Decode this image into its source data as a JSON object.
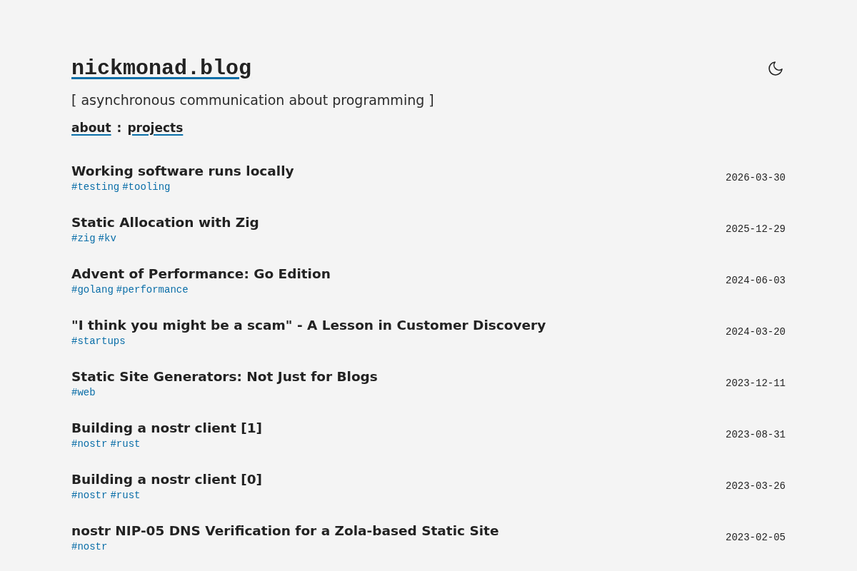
{
  "header": {
    "site_title": "nickmonad.blog",
    "tagline": "[ asynchronous communication about programming ]",
    "nav": [
      {
        "label": "about"
      },
      {
        "label": "projects"
      }
    ],
    "nav_separator": ":"
  },
  "posts": [
    {
      "title": "Working software runs locally",
      "tags": [
        "#testing",
        "#tooling"
      ],
      "date": "2026-03-30"
    },
    {
      "title": "Static Allocation with Zig",
      "tags": [
        "#zig",
        "#kv"
      ],
      "date": "2025-12-29"
    },
    {
      "title": "Advent of Performance: Go Edition",
      "tags": [
        "#golang",
        "#performance"
      ],
      "date": "2024-06-03"
    },
    {
      "title": "\"I think you might be a scam\" - A Lesson in Customer Discovery",
      "tags": [
        "#startups"
      ],
      "date": "2024-03-20"
    },
    {
      "title": "Static Site Generators: Not Just for Blogs",
      "tags": [
        "#web"
      ],
      "date": "2023-12-11"
    },
    {
      "title": "Building a nostr client [1]",
      "tags": [
        "#nostr",
        "#rust"
      ],
      "date": "2023-08-31"
    },
    {
      "title": "Building a nostr client [0]",
      "tags": [
        "#nostr",
        "#rust"
      ],
      "date": "2023-03-26"
    },
    {
      "title": "nostr NIP-05 DNS Verification for a Zola-based Static Site",
      "tags": [
        "#nostr"
      ],
      "date": "2023-02-05"
    }
  ]
}
